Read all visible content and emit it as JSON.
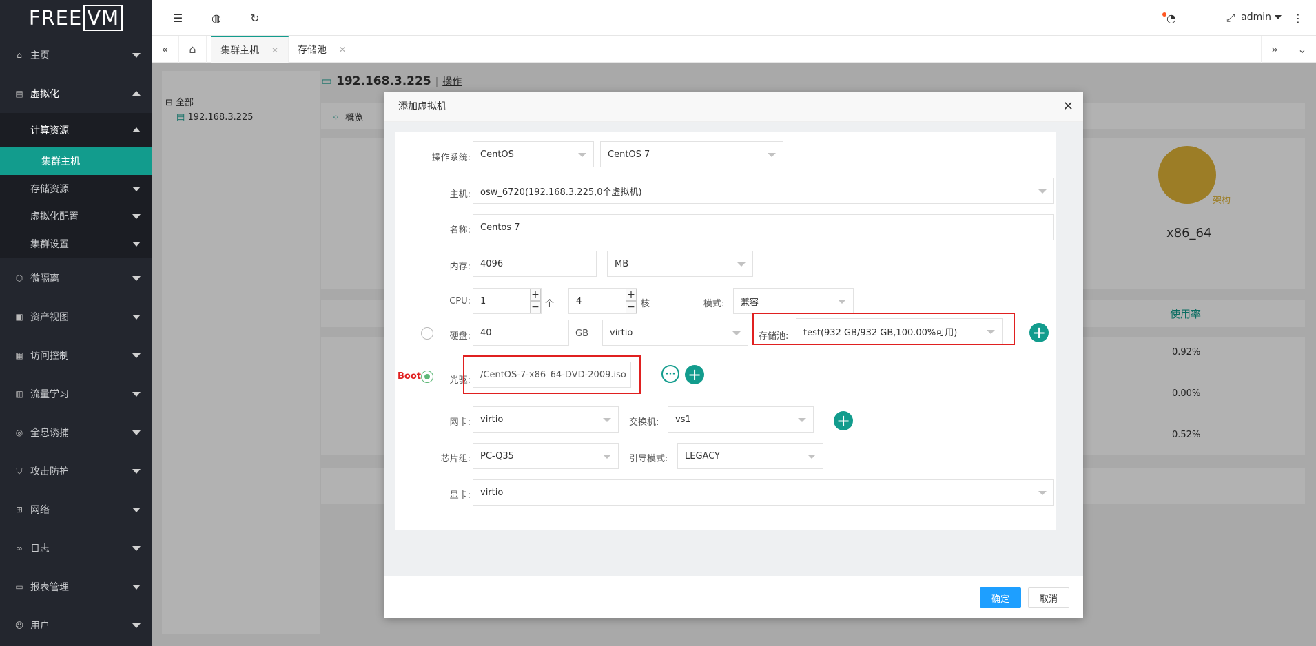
{
  "sidebar": {
    "logo": "FREEVM",
    "logo_main": "FREE",
    "logo_boxed": "VM",
    "items": [
      {
        "label": "主页",
        "icon": "home-icon"
      },
      {
        "label": "虚拟化",
        "icon": "server-icon"
      },
      {
        "label": "微隔离",
        "icon": "cube-icon"
      },
      {
        "label": "资产视图",
        "icon": "asset-icon"
      },
      {
        "label": "访问控制",
        "icon": "grid-icon"
      },
      {
        "label": "流量学习",
        "icon": "traffic-icon"
      },
      {
        "label": "全息诱捕",
        "icon": "trap-icon"
      },
      {
        "label": "攻击防护",
        "icon": "shield-icon"
      },
      {
        "label": "网络",
        "icon": "network-icon"
      },
      {
        "label": "日志",
        "icon": "log-icon"
      },
      {
        "label": "报表管理",
        "icon": "report-icon"
      },
      {
        "label": "用户",
        "icon": "user-icon"
      }
    ],
    "submenu": {
      "head": "计算资源",
      "active": "集群主机",
      "items": [
        "存储资源",
        "虚拟化配置",
        "集群设置"
      ]
    }
  },
  "header": {
    "user": "admin"
  },
  "tabs": [
    {
      "label": "集群主机"
    },
    {
      "label": "存储池"
    }
  ],
  "background": {
    "tree_root": "全部",
    "tree_host": "192.168.3.225",
    "host_title": "192.168.3.225",
    "host_action": "操作",
    "overview_tab": "概览",
    "arch_label": "架构",
    "arch_value": "x86_64",
    "usage_header": "使用率",
    "usage_values": [
      "0.92%",
      "0.00%",
      "0.52%"
    ]
  },
  "dialog": {
    "title": "添加虚拟机",
    "os_label": "操作系统:",
    "os_value": "CentOS",
    "os_version": "CentOS 7",
    "host_label": "主机:",
    "host_value": "osw_6720(192.168.3.225,0个虚拟机)",
    "name_label": "名称:",
    "name_value": "Centos 7",
    "mem_label": "内存:",
    "mem_value": "4096",
    "mem_unit": "MB",
    "cpu_label": "CPU:",
    "cpu_count": "1",
    "cpu_count_unit": "个",
    "cpu_cores": "4",
    "cpu_cores_unit": "核",
    "mode_label": "模式:",
    "mode_value": "兼容",
    "disk_label": "硬盘:",
    "disk_size": "40",
    "disk_unit": "GB",
    "disk_bus": "virtio",
    "pool_label": "存储池:",
    "pool_value": "test(932 GB/932 GB,100.00%可用)",
    "boot_label": "Boot",
    "cdrom_label": "光驱:",
    "cdrom_value": "/CentOS-7-x86_64-DVD-2009.iso",
    "nic_label": "网卡:",
    "nic_value": "virtio",
    "switch_label": "交换机:",
    "switch_value": "vs1",
    "chipset_label": "芯片组:",
    "chipset_value": "PC-Q35",
    "bootmode_label": "引导模式:",
    "bootmode_value": "LEGACY",
    "gpu_label": "显卡:",
    "gpu_value": "virtio",
    "ok": "确定",
    "cancel": "取消"
  },
  "colors": {
    "accent": "#129c8d",
    "sidebar_bg": "#23262e",
    "primary_button": "#1e9fff",
    "highlight_box": "#e02020",
    "arch_circle": "#e0b437"
  }
}
